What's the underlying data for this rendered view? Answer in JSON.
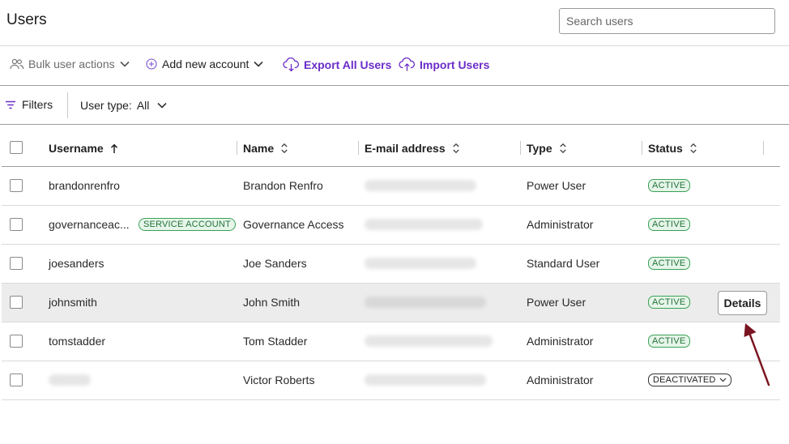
{
  "header": {
    "title": "Users",
    "search_placeholder": "Search users"
  },
  "toolbar": {
    "bulk_actions": "Bulk user actions",
    "add_account": "Add new account",
    "export": "Export All Users",
    "import": "Import Users"
  },
  "filterbar": {
    "filters_label": "Filters",
    "user_type_label": "User type:",
    "user_type_value": "All"
  },
  "table": {
    "columns": {
      "username": "Username",
      "name": "Name",
      "email": "E-mail address",
      "type": "Type",
      "status": "Status"
    },
    "rows": [
      {
        "username": "brandonrenfro",
        "name": "Brandon Renfro",
        "type": "Power User",
        "status": "ACTIVE"
      },
      {
        "username": "governanceac...",
        "badge": "SERVICE ACCOUNT",
        "name": "Governance Access",
        "type": "Administrator",
        "status": "ACTIVE"
      },
      {
        "username": "joesanders",
        "name": "Joe Sanders",
        "type": "Standard User",
        "status": "ACTIVE"
      },
      {
        "username": "johnsmith",
        "name": "John Smith",
        "type": "Power User",
        "status": "ACTIVE",
        "action": "Details"
      },
      {
        "username": "tomstadder",
        "name": "Tom Stadder",
        "type": "Administrator",
        "status": "ACTIVE"
      },
      {
        "username": "",
        "name": "Victor Roberts",
        "type": "Administrator",
        "status": "DEACTIVATED"
      }
    ]
  },
  "colors": {
    "accent_purple": "#6a2cc9",
    "active_green": "#23733a",
    "arrow": "#7a1420"
  }
}
